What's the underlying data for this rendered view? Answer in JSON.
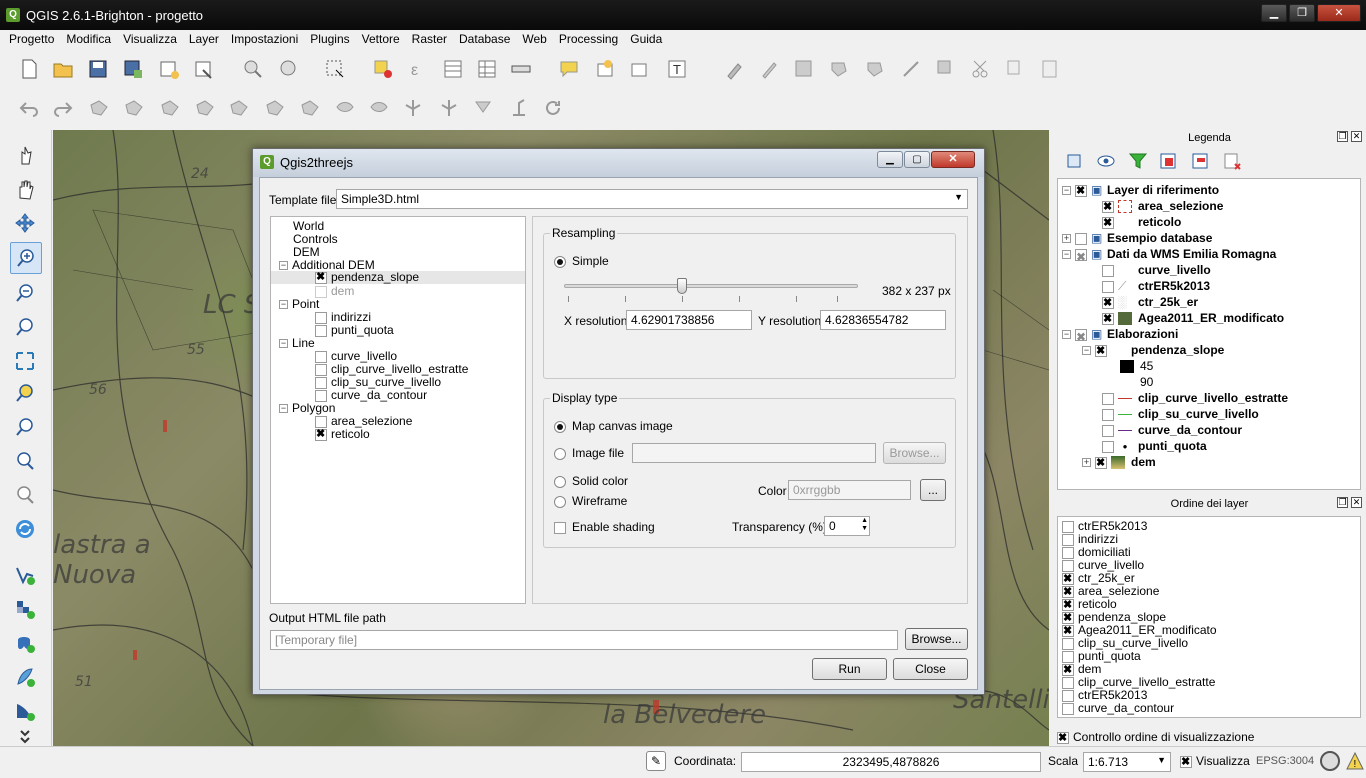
{
  "window": {
    "title": "QGIS 2.6.1-Brighton - progetto",
    "minimize": "▁",
    "maximize": "❐",
    "close": "✕"
  },
  "menu": [
    "Progetto",
    "Modifica",
    "Visualizza",
    "Layer",
    "Impostazioni",
    "Plugins",
    "Vettore",
    "Raster",
    "Database",
    "Web",
    "Processing",
    "Guida"
  ],
  "map_labels": [
    "24",
    "55",
    "56",
    "51",
    "lastra a",
    "Nuova",
    "LC S",
    "la Belvedere",
    "Santelli"
  ],
  "legend": {
    "title": "Legenda",
    "items": [
      {
        "label": "Layer di riferimento",
        "bold": true,
        "checked": true,
        "expander": "−",
        "level": 0,
        "group": true
      },
      {
        "label": "area_selezione",
        "bold": true,
        "checked": true,
        "level": 1
      },
      {
        "label": "reticolo",
        "bold": true,
        "checked": true,
        "level": 1
      },
      {
        "label": "Esempio database",
        "bold": true,
        "checked": false,
        "expander": "+",
        "level": 0,
        "group": true
      },
      {
        "label": "Dati da WMS Emilia Romagna",
        "bold": true,
        "checked": true,
        "expander": "−",
        "level": 0,
        "group": true
      },
      {
        "label": "curve_livello",
        "bold": true,
        "checked": false,
        "level": 1
      },
      {
        "label": "ctrER5k2013",
        "bold": true,
        "checked": false,
        "level": 1
      },
      {
        "label": "ctr_25k_er",
        "bold": true,
        "checked": true,
        "level": 1
      },
      {
        "label": "Agea2011_ER_modificato",
        "bold": true,
        "checked": true,
        "level": 1
      },
      {
        "label": "Elaborazioni",
        "bold": true,
        "checked": true,
        "expander": "−",
        "level": 0,
        "group": true
      },
      {
        "label": "pendenza_slope",
        "bold": true,
        "checked": true,
        "expander": "−",
        "level": 1
      },
      {
        "label": "45",
        "bold": false,
        "level": 2,
        "swatch": "#000000"
      },
      {
        "label": "90",
        "bold": false,
        "level": 2,
        "swatch": "#ffffff"
      },
      {
        "label": "clip_curve_livello_estratte",
        "bold": true,
        "checked": false,
        "level": 1,
        "line": "#c0392b"
      },
      {
        "label": "clip_su_curve_livello",
        "bold": true,
        "checked": false,
        "level": 1,
        "line": "#3bb33b"
      },
      {
        "label": "curve_da_contour",
        "bold": true,
        "checked": false,
        "level": 1,
        "line": "#6a2a8a"
      },
      {
        "label": "punti_quota",
        "bold": true,
        "checked": false,
        "level": 1,
        "dot": true
      },
      {
        "label": "dem",
        "bold": true,
        "checked": true,
        "expander": "+",
        "level": 0
      }
    ]
  },
  "order": {
    "title": "Ordine dei layer",
    "items": [
      {
        "label": "ctrER5k2013",
        "checked": false
      },
      {
        "label": "indirizzi",
        "checked": false
      },
      {
        "label": "domiciliati",
        "checked": false
      },
      {
        "label": "curve_livello",
        "checked": false
      },
      {
        "label": "ctr_25k_er",
        "checked": true
      },
      {
        "label": "area_selezione",
        "checked": true
      },
      {
        "label": "reticolo",
        "checked": true
      },
      {
        "label": "pendenza_slope",
        "checked": true
      },
      {
        "label": "Agea2011_ER_modificato",
        "checked": true
      },
      {
        "label": "clip_su_curve_livello",
        "checked": false
      },
      {
        "label": "punti_quota",
        "checked": false
      },
      {
        "label": "dem",
        "checked": true
      },
      {
        "label": "clip_curve_livello_estratte",
        "checked": false
      },
      {
        "label": "ctrER5k2013",
        "checked": false
      },
      {
        "label": "curve_da_contour",
        "checked": false
      }
    ],
    "control_label": "Controllo ordine di visualizzazione",
    "control_checked": true
  },
  "status": {
    "coord_label": "Coordinata:",
    "coord_value": "2323495,4878826",
    "scale_label": "Scala",
    "scale_value": "1:6.713",
    "render_label": "Visualizza",
    "epsg": "EPSG:3004"
  },
  "dialog": {
    "title": "Qgis2threejs",
    "template_label": "Template file",
    "template_value": "Simple3D.html",
    "tree": [
      {
        "label": "World",
        "level": 0
      },
      {
        "label": "Controls",
        "level": 0
      },
      {
        "label": "DEM",
        "level": 0
      },
      {
        "label": "Additional DEM",
        "level": 0,
        "expander": "−"
      },
      {
        "label": "pendenza_slope",
        "level": 1,
        "checked": true,
        "selected": true
      },
      {
        "label": "dem",
        "level": 1,
        "checked": false,
        "disabled": true
      },
      {
        "label": "Point",
        "level": 0,
        "expander": "−"
      },
      {
        "label": "indirizzi",
        "level": 1,
        "checked": false
      },
      {
        "label": "punti_quota",
        "level": 1,
        "checked": false
      },
      {
        "label": "Line",
        "level": 0,
        "expander": "−"
      },
      {
        "label": "curve_livello",
        "level": 1,
        "checked": false
      },
      {
        "label": "clip_curve_livello_estratte",
        "level": 1,
        "checked": false
      },
      {
        "label": "clip_su_curve_livello",
        "level": 1,
        "checked": false
      },
      {
        "label": "curve_da_contour",
        "level": 1,
        "checked": false
      },
      {
        "label": "Polygon",
        "level": 0,
        "expander": "−"
      },
      {
        "label": "area_selezione",
        "level": 1,
        "checked": false
      },
      {
        "label": "reticolo",
        "level": 1,
        "checked": true
      }
    ],
    "resampling": {
      "title": "Resampling",
      "simple_label": "Simple",
      "size_text": "382 x 237 px",
      "slider_fraction": 0.4,
      "x_label": "X resolution",
      "x_value": "4.62901738856",
      "y_label": "Y resolution",
      "y_value": "4.62836554782"
    },
    "display": {
      "title": "Display type",
      "map_canvas_label": "Map canvas image",
      "image_file_label": "Image file",
      "browse_label": "Browse...",
      "solid_color_label": "Solid color",
      "wireframe_label": "Wireframe",
      "color_label": "Color",
      "color_placeholder": "0xrrggbb",
      "color_btn": "...",
      "shading_label": "Enable shading",
      "transparency_label": "Transparency (%)",
      "transparency_value": "0"
    },
    "output_label": "Output HTML file path",
    "output_placeholder": "[Temporary file]",
    "output_browse": "Browse...",
    "run_label": "Run",
    "close_label": "Close"
  }
}
